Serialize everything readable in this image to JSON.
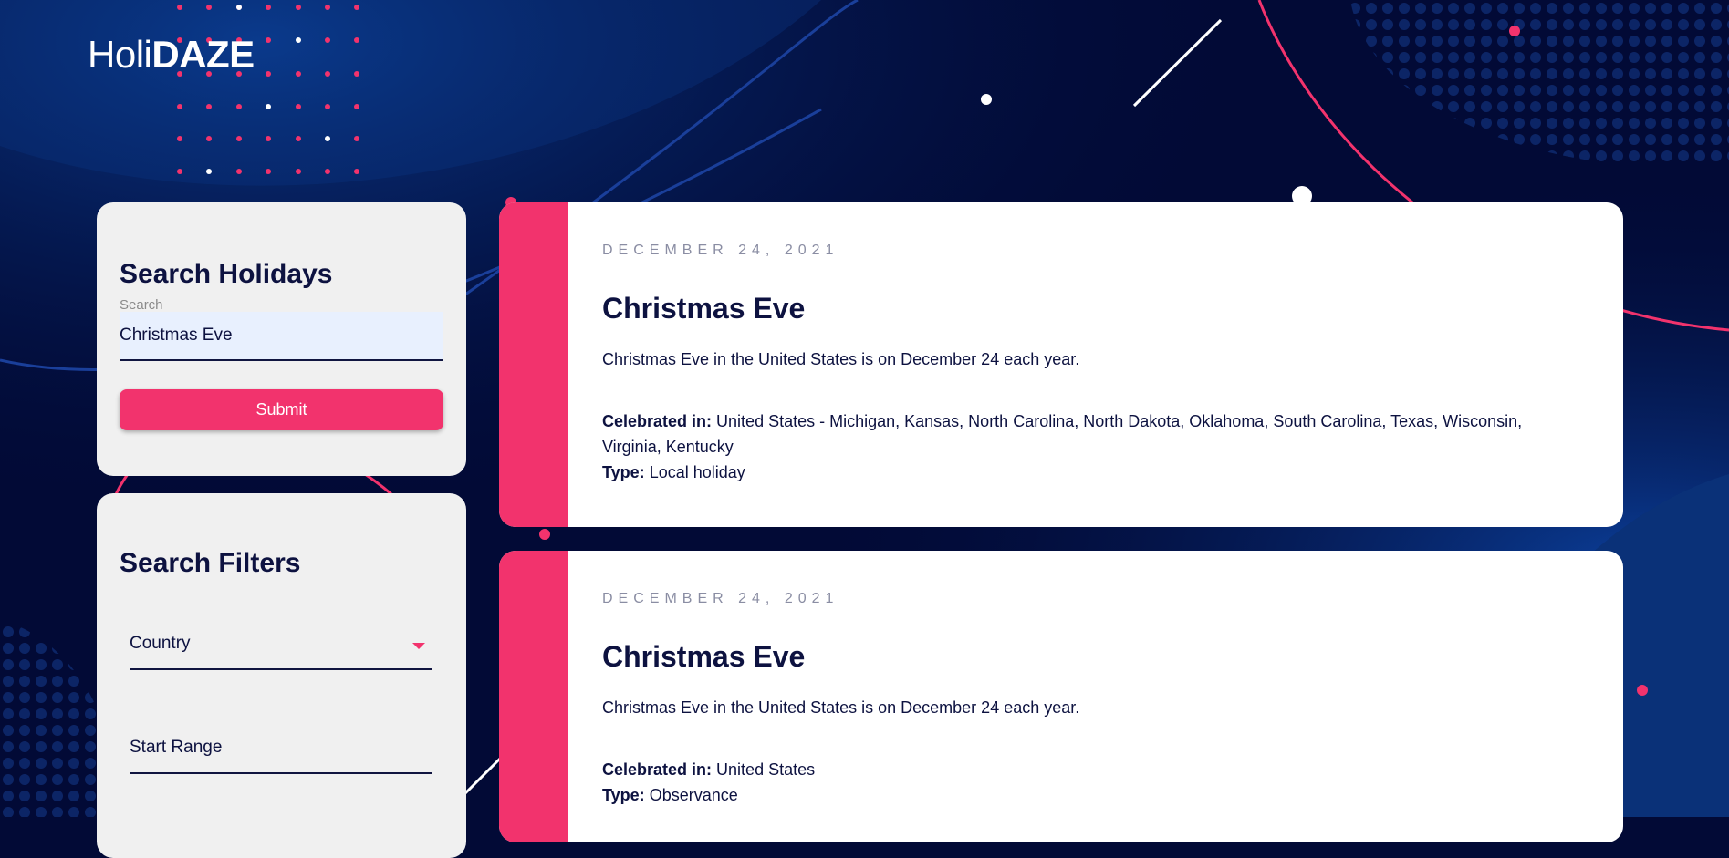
{
  "app": {
    "logo_light": "Holi",
    "logo_bold": "DAZE"
  },
  "colors": {
    "background": "#020a36",
    "accent": "#f2336d",
    "text_dark": "#0d1240",
    "panel": "#f0f0f0"
  },
  "search_panel": {
    "title": "Search Holidays",
    "label": "Search",
    "value": "Christmas Eve",
    "submit_label": "Submit"
  },
  "filters_panel": {
    "title": "Search Filters",
    "country_label": "Country",
    "start_range_label": "Start Range"
  },
  "results": [
    {
      "date": "DECEMBER 24, 2021",
      "name": "Christmas Eve",
      "description": "Christmas Eve in the United States is on December 24 each year.",
      "celebrated_label": "Celebrated in:",
      "celebrated_value": "United States - Michigan, Kansas, North Carolina, North Dakota, Oklahoma, South Carolina, Texas, Wisconsin, Virginia, Kentucky",
      "type_label": "Type:",
      "type_value": "Local holiday"
    },
    {
      "date": "DECEMBER 24, 2021",
      "name": "Christmas Eve",
      "description": "Christmas Eve in the United States is on December 24 each year.",
      "celebrated_label": "Celebrated in:",
      "celebrated_value": "United States",
      "type_label": "Type:",
      "type_value": "Observance"
    }
  ]
}
